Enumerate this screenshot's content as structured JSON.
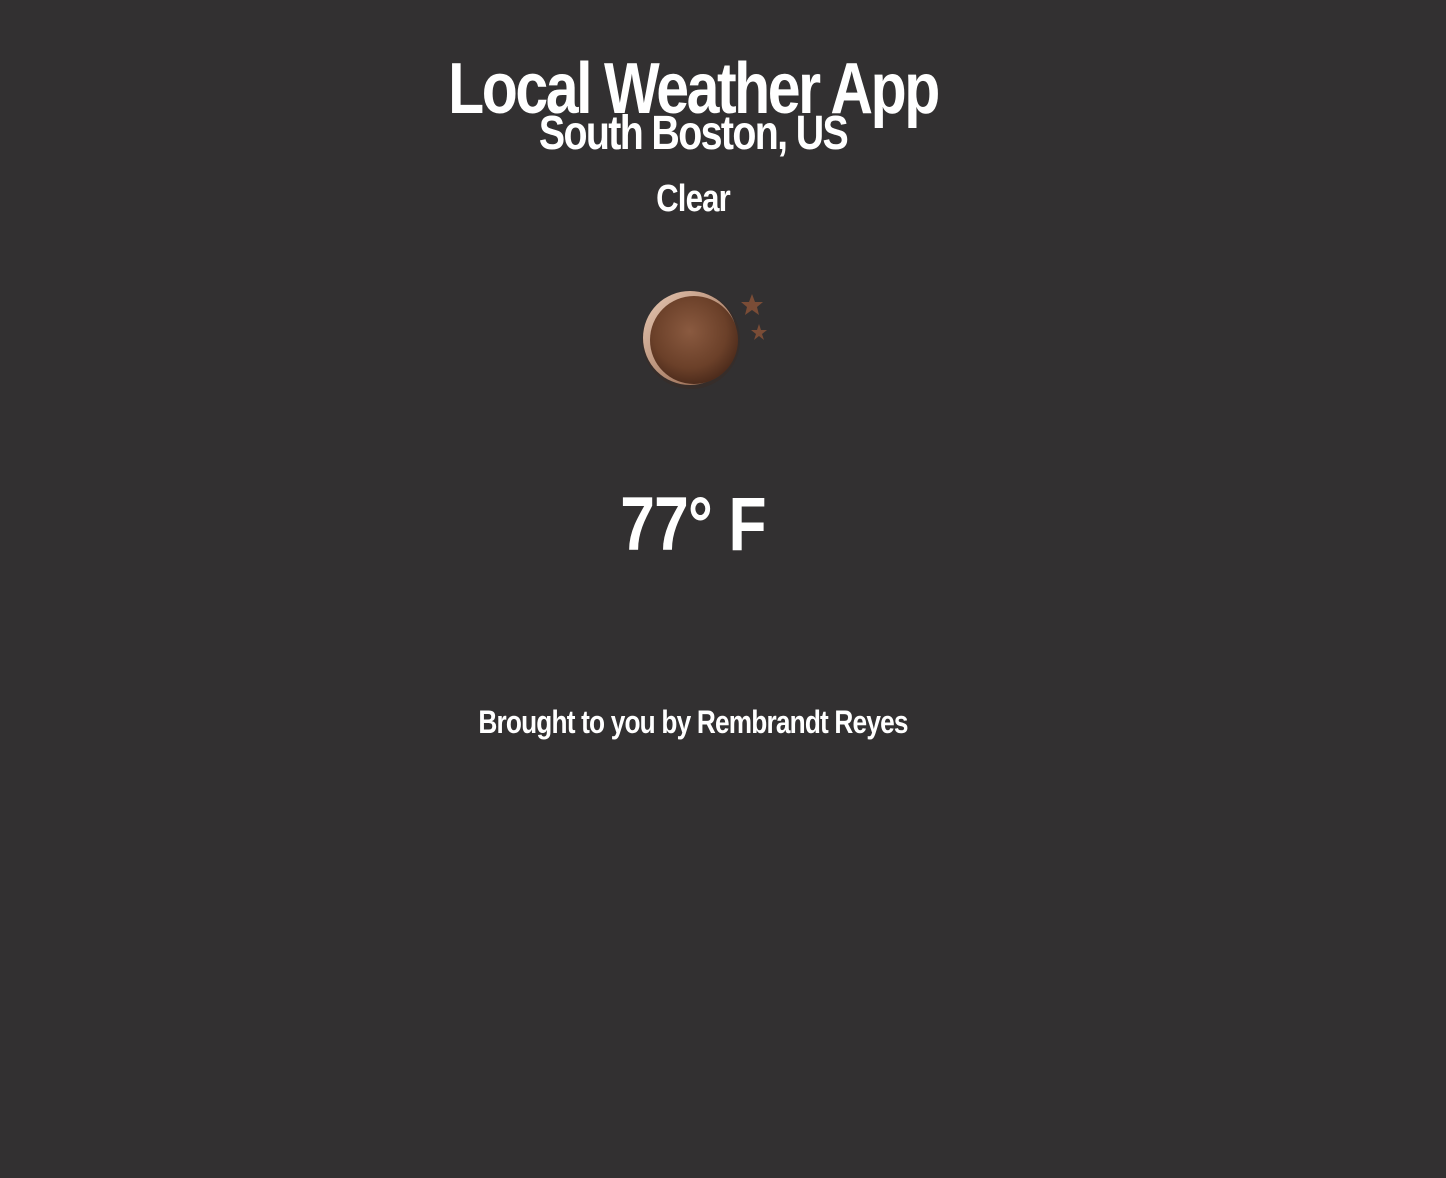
{
  "app": {
    "title": "Local Weather App"
  },
  "weather": {
    "location": "South Boston, US",
    "condition": "Clear",
    "icon": "moon-stars-icon",
    "temperature": "77° F"
  },
  "footer": {
    "credit": "Brought to you by Rembrandt Reyes"
  },
  "colors": {
    "background": "#323031",
    "text": "#ffffff",
    "icon_moon": "#6e4430",
    "icon_stars": "#7a4c36"
  }
}
